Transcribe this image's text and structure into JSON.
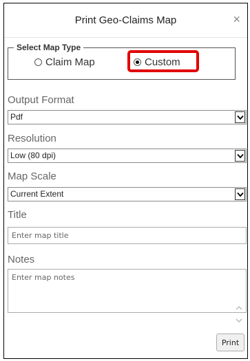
{
  "dialog": {
    "title": "Print Geo-Claims Map",
    "close_icon": "×"
  },
  "map_type": {
    "legend": "Select Map Type",
    "options": [
      {
        "label": "Claim Map",
        "selected": false
      },
      {
        "label": "Custom",
        "selected": true
      }
    ],
    "highlight_color": "#e00000"
  },
  "output_format": {
    "label": "Output Format",
    "value": "Pdf"
  },
  "resolution": {
    "label": "Resolution",
    "value": "Low (80 dpi)"
  },
  "map_scale": {
    "label": "Map Scale",
    "value": "Current Extent"
  },
  "title_field": {
    "label": "Title",
    "placeholder": "Enter map title"
  },
  "notes_field": {
    "label": "Notes",
    "placeholder": "Enter map notes"
  },
  "actions": {
    "print_label": "Print"
  }
}
